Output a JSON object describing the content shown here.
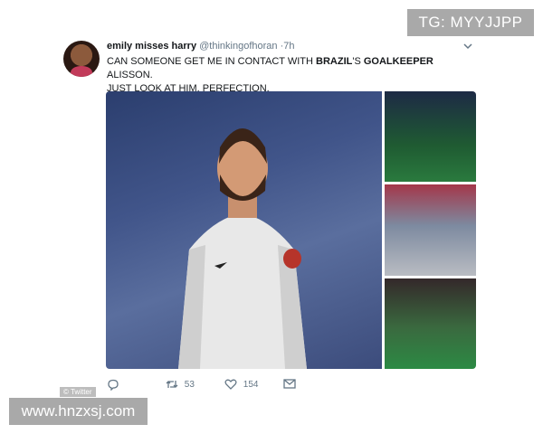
{
  "watermarks": {
    "top_right": "TG: MYYJJPP",
    "bottom_left": "www.hnzxsj.com",
    "source": "© Twitter"
  },
  "tweet": {
    "display_name": "emily misses harry",
    "handle": "@thinkingofhoran",
    "time": "·7h",
    "text_part1": "CAN SOMEONE GET ME IN CONTACT WITH ",
    "text_bold1": "BRAZIL",
    "text_part2": "'S ",
    "text_bold2": "GOALKEEPER",
    "text_part3": " ALISSON.",
    "text_line2": "JUST LOOK AT HIM. PERFECTION.",
    "retweets": "53",
    "likes": "154"
  },
  "icons": [
    "avatar",
    "chevron-down-icon",
    "reply-icon",
    "retweet-icon",
    "heart-icon",
    "message-icon"
  ],
  "colors": {
    "text": "#14171a",
    "muted": "#657786",
    "watermark": "#a9a9a9"
  }
}
